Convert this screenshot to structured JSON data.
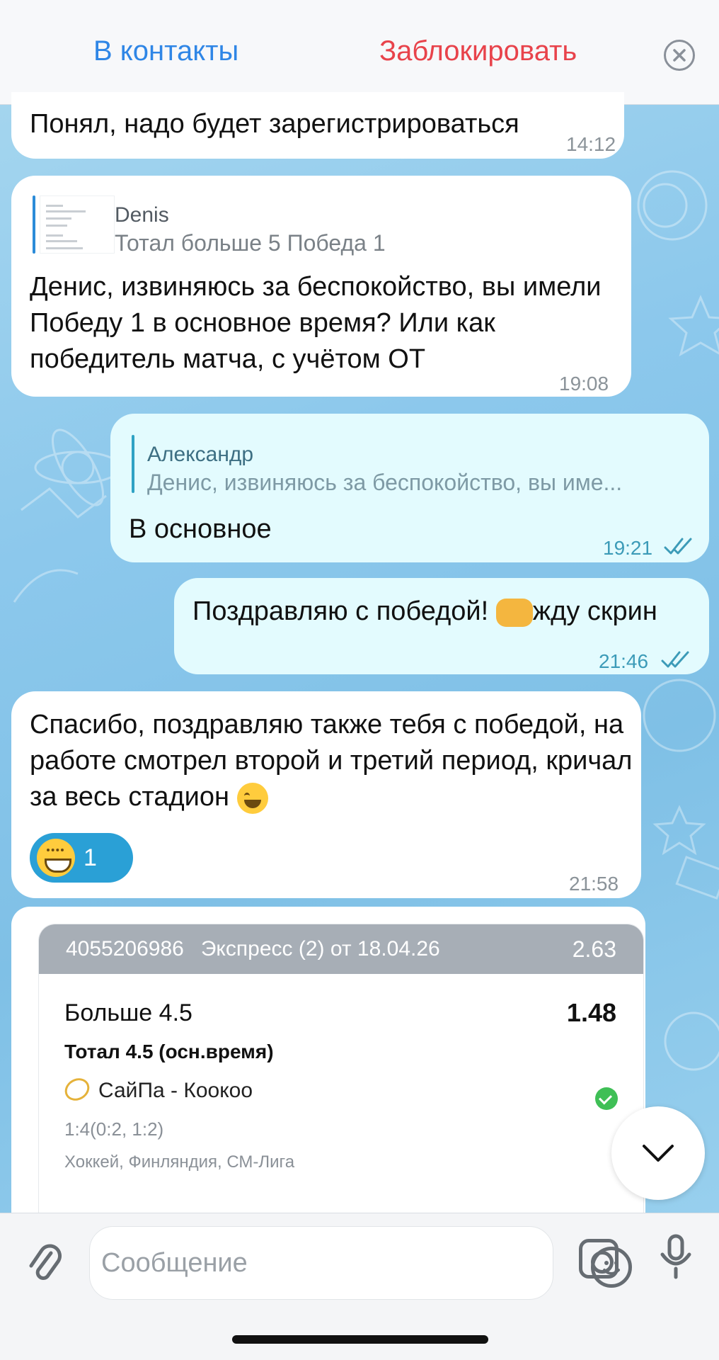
{
  "header": {
    "add_contact_label": "В контакты",
    "block_label": "Заблокировать",
    "close_icon": "close-circle-icon"
  },
  "messages": [
    {
      "direction": "in",
      "text": "Понял, надо будет зарегистрироваться",
      "time": "14:12"
    },
    {
      "direction": "in",
      "reply": {
        "name": "Denis",
        "text": "Тотал больше 5 Победа 1"
      },
      "text": "Денис, извиняюсь за беспокойство, вы имели Победу 1 в основное время? Или как победитель матча, с учётом ОТ",
      "time": "19:08"
    },
    {
      "direction": "out",
      "reply": {
        "name": "Александр",
        "text": "Денис, извиняюсь за беспокойство, вы име..."
      },
      "text": "В основное",
      "time": "19:21"
    },
    {
      "direction": "out",
      "text_before": "Поздравляю с победой! ",
      "text_after": "жду скрин",
      "time": "21:46"
    },
    {
      "direction": "in",
      "text": "Спасибо, поздравляю также тебя с победой, на работе смотрел второй и третий период, кричал за весь стадион",
      "reaction_count": "1",
      "time": "21:58"
    }
  ],
  "bet_card": {
    "number": "4055206986",
    "type": "Экспресс (2) от 18.04.26",
    "total_odds": "2.63",
    "selection": "Больше 4.5",
    "selection_odds": "1.48",
    "market": "Тотал 4.5 (осн.время)",
    "match": "СайПа - Коокоо",
    "score": "1:4(0:2, 1:2)",
    "league": "Хоккей, Финляндия, СМ-Лига",
    "status_icon": "check-circle-icon"
  },
  "composer": {
    "placeholder": "Сообщение"
  },
  "colors": {
    "accent_blue": "#2f86e6",
    "danger_red": "#e8434b",
    "outgoing_bubble": "#e3fbfe",
    "reaction_blue": "#2aa0d6",
    "success_green": "#3fbf56"
  }
}
